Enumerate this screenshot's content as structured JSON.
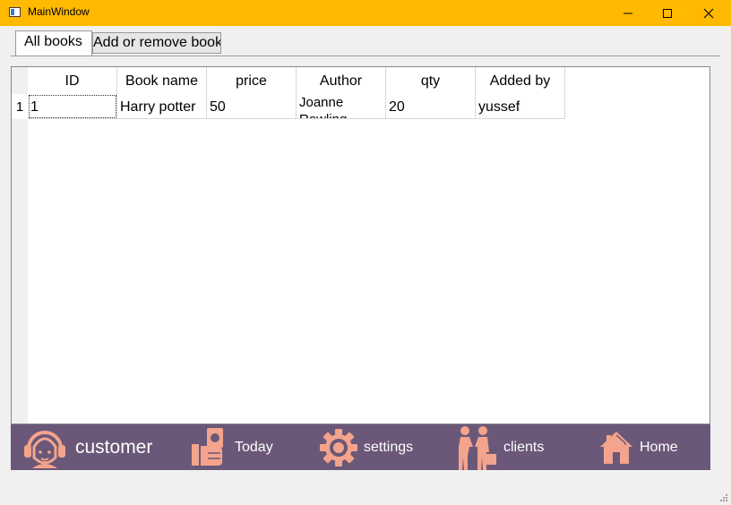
{
  "window": {
    "title": "MainWindow"
  },
  "tabs": [
    {
      "label": "All books",
      "active": true
    },
    {
      "label": "Add or remove books",
      "active": false
    }
  ],
  "table": {
    "columns": [
      "ID",
      "Book name",
      "price",
      "Author",
      "qty",
      "Added by"
    ],
    "rows": [
      {
        "row_header": "1",
        "cells": [
          "1",
          "Harry potter",
          "50",
          "Joanne Rowling",
          "20",
          "yussef"
        ]
      }
    ]
  },
  "nav": {
    "items": [
      {
        "label": "customer",
        "icon": "headset-woman-icon"
      },
      {
        "label": "Today",
        "icon": "hand-money-icon"
      },
      {
        "label": "settings",
        "icon": "gear-icon"
      },
      {
        "label": "clients",
        "icon": "handshake-icon"
      },
      {
        "label": "Home",
        "icon": "house-icon"
      }
    ],
    "background": "#6b5878",
    "icon_color": "#f4a48c"
  },
  "colors": {
    "titlebar": "#ffb900"
  }
}
